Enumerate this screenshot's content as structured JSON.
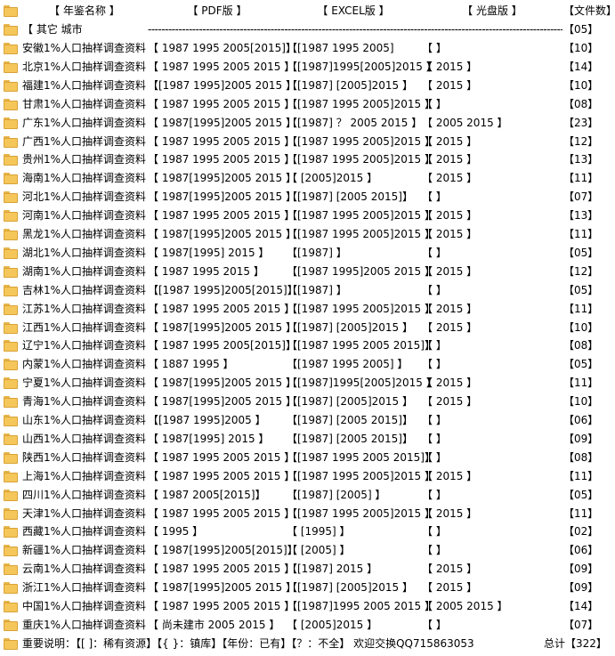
{
  "header": {
    "name": "【      年鉴名称      】",
    "pdf": "【            PDF版             】",
    "excel": "【          EXCEL版           】",
    "cd": "【           光盘版           】",
    "count": "【文件数】"
  },
  "city_row": {
    "name": "【      其它 城市",
    "dashes": "--------------------------------------------------------------------------------------------------------------------------------",
    "count": "【05】"
  },
  "rows": [
    {
      "name": "安徽1%人口抽样调查资料",
      "pdf": "【 1987 1995 2005[2015]】",
      "excel": "【[1987 1995 2005]",
      "cd": "【                                 】",
      "count": "【10】"
    },
    {
      "name": "北京1%人口抽样调查资料",
      "pdf": "【 1987 1995 2005 2015 】",
      "excel": "【[1987]1995[2005]2015 】",
      "cd": "【                          2015 】",
      "count": "【14】"
    },
    {
      "name": "福建1%人口抽样调查资料",
      "pdf": "【[1987 1995]2005 2015 】",
      "excel": "【[1987]      [2005]2015 】",
      "cd": "【                          2015 】",
      "count": "【10】"
    },
    {
      "name": "甘肃1%人口抽样调查资料",
      "pdf": "【 1987 1995 2005 2015 】",
      "excel": "【[1987 1995 2005]2015 】",
      "cd": "【                                 】",
      "count": "【08】"
    },
    {
      "name": "广东1%人口抽样调查资料",
      "pdf": "【 1987[1995]2005 2015 】",
      "excel": "【[1987]     ？  2005 2015 】",
      "cd": "【                   2005 2015 】",
      "count": "【23】"
    },
    {
      "name": "广西1%人口抽样调查资料",
      "pdf": "【 1987 1995 2005 2015 】",
      "excel": "【[1987 1995 2005]2015 】",
      "cd": "【                          2015 】",
      "count": "【12】"
    },
    {
      "name": "贵州1%人口抽样调查资料",
      "pdf": "【 1987 1995 2005 2015 】",
      "excel": "【[1987 1995 2005]2015 】",
      "cd": "【                          2015 】",
      "count": "【13】"
    },
    {
      "name": "海南1%人口抽样调查资料",
      "pdf": "【 1987[1995]2005 2015 】",
      "excel": "【                 [2005]2015 】",
      "cd": "【                          2015 】",
      "count": "【11】"
    },
    {
      "name": "河北1%人口抽样调查资料",
      "pdf": "【 1987[1995]2005 2015 】",
      "excel": "【[1987]      [2005 2015]】",
      "cd": "【                                 】",
      "count": "【07】"
    },
    {
      "name": "河南1%人口抽样调查资料",
      "pdf": "【 1987 1995 2005 2015 】",
      "excel": "【[1987 1995 2005]2015 】",
      "cd": "【                          2015 】",
      "count": "【13】"
    },
    {
      "name": "黑龙1%人口抽样调查资料",
      "pdf": "【 1987[1995]2005 2015 】",
      "excel": "【[1987 1995 2005]2015 】",
      "cd": "【                          2015 】",
      "count": "【11】"
    },
    {
      "name": "湖北1%人口抽样调查资料",
      "pdf": "【 1987[1995]         2015 】",
      "excel": "【[1987]                          】",
      "cd": "【                                 】",
      "count": "【05】"
    },
    {
      "name": "湖南1%人口抽样调查资料",
      "pdf": "【 1987 1995         2015 】",
      "excel": "【[1987 1995]2005 2015 】",
      "cd": "【                          2015 】",
      "count": "【12】"
    },
    {
      "name": "吉林1%人口抽样调查资料",
      "pdf": "【[1987 1995]2005[2015]】",
      "excel": "【[1987]                          】",
      "cd": "【                                 】",
      "count": "【05】"
    },
    {
      "name": "江苏1%人口抽样调查资料",
      "pdf": "【 1987 1995 2005 2015 】",
      "excel": "【[1987 1995 2005]2015 】",
      "cd": "【                          2015 】",
      "count": "【11】"
    },
    {
      "name": "江西1%人口抽样调查资料",
      "pdf": "【 1987[1995]2005 2015 】",
      "excel": "【[1987]      [2005]2015 】",
      "cd": "【                          2015 】",
      "count": "【10】"
    },
    {
      "name": "辽宁1%人口抽样调查资料",
      "pdf": "【 1987 1995 2005[2015]】",
      "excel": "【[1987 1995 2005 2015]】",
      "cd": "【                                 】",
      "count": "【08】"
    },
    {
      "name": "内蒙1%人口抽样调查资料",
      "pdf": "【 1887 1995                     】",
      "excel": "【[1987 1995 2005]          】",
      "cd": "【                                 】",
      "count": "【05】"
    },
    {
      "name": "宁夏1%人口抽样调查资料",
      "pdf": "【 1987[1995]2005 2015 】",
      "excel": "【[1987]1995[2005]2015 】",
      "cd": "【                          2015 】",
      "count": "【11】"
    },
    {
      "name": "青海1%人口抽样调查资料",
      "pdf": "【 1987[1995]2005 2015 】",
      "excel": "【[1987]      [2005]2015 】",
      "cd": "【                          2015 】",
      "count": "【10】"
    },
    {
      "name": "山东1%人口抽样调查资料",
      "pdf": "【[1987 1995]2005            】",
      "excel": "【[1987]      [2005 2015]】",
      "cd": "【                                 】",
      "count": "【06】"
    },
    {
      "name": "山西1%人口抽样调查资料",
      "pdf": "【 1987[1995]         2015 】",
      "excel": "【[1987]      [2005 2015]】",
      "cd": "【                                 】",
      "count": "【09】"
    },
    {
      "name": "陕西1%人口抽样调查资料",
      "pdf": "【 1987 1995 2005 2015 】",
      "excel": "【[1987 1995 2005 2015]】",
      "cd": "【                                 】",
      "count": "【08】"
    },
    {
      "name": "上海1%人口抽样调查资料",
      "pdf": "【 1987 1995 2005 2015 】",
      "excel": "【[1987 1995 2005]2015 】",
      "cd": "【                          2015 】",
      "count": "【11】"
    },
    {
      "name": "四川1%人口抽样调查资料",
      "pdf": "【 1987         2005[2015]】",
      "excel": "【[1987]      [2005]          】",
      "cd": "【                                 】",
      "count": "【05】"
    },
    {
      "name": "天津1%人口抽样调查资料",
      "pdf": "【 1987 1995 2005 2015 】",
      "excel": "【[1987 1995 2005]2015 】",
      "cd": "【                          2015 】",
      "count": "【11】"
    },
    {
      "name": "西藏1%人口抽样调查资料",
      "pdf": "【          1995                 】",
      "excel": "【          [1995]                 】",
      "cd": "【                                 】",
      "count": "【02】"
    },
    {
      "name": "新疆1%人口抽样调查资料",
      "pdf": "【 1987[1995]2005[2015]】",
      "excel": "【                 [2005]          】",
      "cd": "【                                 】",
      "count": "【06】"
    },
    {
      "name": "云南1%人口抽样调查资料",
      "pdf": "【 1987 1995 2005 2015 】",
      "excel": "【[1987]                  2015 】",
      "cd": "【                          2015 】",
      "count": "【09】"
    },
    {
      "name": "浙江1%人口抽样调查资料",
      "pdf": "【 1987[1995]2005 2015 】",
      "excel": "【[1987]      [2005]2015 】",
      "cd": "【                          2015 】",
      "count": "【09】"
    },
    {
      "name": "中国1%人口抽样调查资料",
      "pdf": "【 1987 1995 2005 2015 】",
      "excel": "【[1987]1995 2005 2015 】",
      "cd": "【                   2005 2015 】",
      "count": "【14】"
    },
    {
      "name": "重庆1%人口抽样调查资料",
      "pdf": "【  尚未建市   2005 2015 】",
      "excel": "【                 [2005]2015 】",
      "cd": "【                                 】",
      "count": "【07】"
    }
  ],
  "footer": {
    "note": "重要说明：【[ ]：稀有资源】【{ }：镇库】【年份：已有】【？：不全】 欢迎交换QQ715863053",
    "total": "总计【322】"
  }
}
